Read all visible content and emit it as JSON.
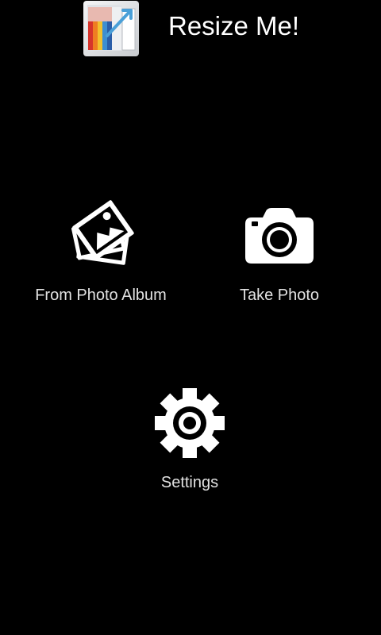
{
  "app": {
    "title": "Resize Me!",
    "logo_icon": "resize-me-app-icon"
  },
  "actions": [
    {
      "id": "from-photo-album",
      "label": "From Photo Album",
      "icon": "photo-stack-icon"
    },
    {
      "id": "take-photo",
      "label": "Take Photo",
      "icon": "camera-icon"
    },
    {
      "id": "settings",
      "label": "Settings",
      "icon": "gear-icon"
    }
  ],
  "colors": {
    "background": "#000000",
    "title_text": "#ffffff",
    "label_text": "#e2e2e2",
    "icon": "#ffffff"
  }
}
